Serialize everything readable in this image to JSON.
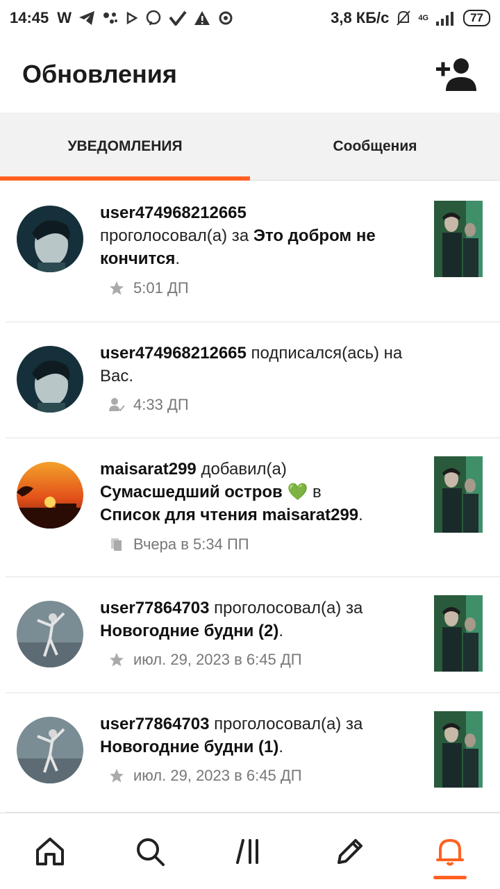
{
  "status_bar": {
    "time": "14:45",
    "speed": "3,8 КБ/с",
    "network": "4G",
    "battery": "77"
  },
  "app_bar": {
    "title": "Обновления"
  },
  "tabs": [
    {
      "label": "УВЕДОМЛЕНИЯ",
      "active": true
    },
    {
      "label": "Сообщения",
      "active": false
    }
  ],
  "notifications": [
    {
      "user": "user474968212665",
      "action": "проголосовал(а) за",
      "target": "Это добром не кончится",
      "time": "5:01 ДП",
      "meta_icon": "star-icon"
    },
    {
      "user": "user474968212665",
      "action": "подписался(ась) на Вас.",
      "time": "4:33 ДП",
      "meta_icon": "follow-icon"
    },
    {
      "user": "maisarat299",
      "action": "добавил(а)",
      "target": "Сумасшедший остров",
      "emoji": "💚",
      "connector": "в",
      "list": "Список для чтения maisarat299",
      "time": "Вчера в 5:34 ПП",
      "meta_icon": "reading-list-icon"
    },
    {
      "user": "user77864703",
      "action": "проголосовал(а) за",
      "target": "Новогодние будни (2)",
      "time": "июл. 29, 2023 в 6:45 ДП",
      "meta_icon": "star-icon"
    },
    {
      "user": "user77864703",
      "action": "проголосовал(а) за",
      "target": "Новогодние будни (1)",
      "time": "июл. 29, 2023 в 6:45 ДП",
      "meta_icon": "star-icon"
    }
  ],
  "bottom_nav": [
    {
      "name": "home-icon",
      "active": false
    },
    {
      "name": "search-icon",
      "active": false
    },
    {
      "name": "library-icon",
      "active": false
    },
    {
      "name": "write-icon",
      "active": false
    },
    {
      "name": "bell-icon",
      "active": true
    }
  ],
  "colors": {
    "accent": "#ff6122",
    "tab_background": "#f3f2f2",
    "muted_text": "#777777"
  }
}
